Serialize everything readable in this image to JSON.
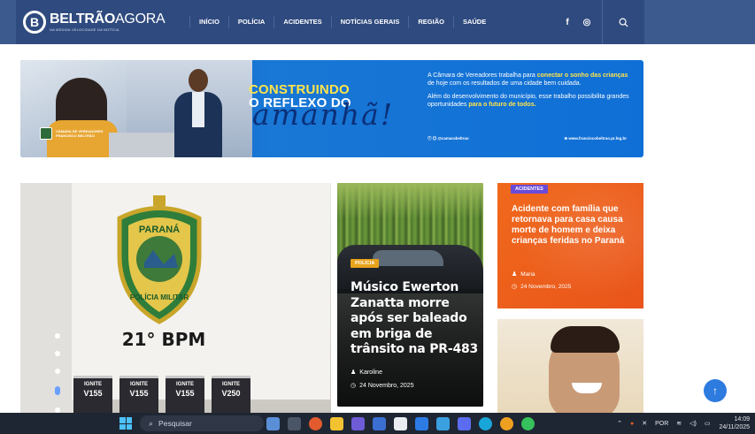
{
  "header": {
    "logo_bold": "BELTRÃO",
    "logo_light": "AGORA",
    "logo_tagline": "NA MEDIDA VELOCIDADE DA NOTÍCIA",
    "nav": [
      "INÍCIO",
      "POLÍCIA",
      "ACIDENTES",
      "NOTÍCIAS GERAIS",
      "REGIÃO",
      "SAÚDE"
    ],
    "social": {
      "facebook": "f",
      "instagram": "◎"
    }
  },
  "banner": {
    "seal_line1": "CÂMARA DE VEREADORES",
    "seal_line2": "FRANCISCO BELTRÃO",
    "title_line1": "CONSTRUINDO",
    "title_line2": "O REFLEXO DO",
    "script": "amanhã!",
    "p1_a": "A Câmara de Vereadores  trabalha para ",
    "p1_hl": "conectar o sonho das crianças",
    "p1_b": " de hoje com os resultados de uma cidade bem cuidada.",
    "p2_a": "Além do desenvolvimento do município, esse trabalho possibilita grandes oportunidades ",
    "p2_hl": "para o futuro de todos.",
    "handle": "@camarabeltrao",
    "site": "www.franciscobeltrao.pr.leg.br"
  },
  "slider": {
    "emblem_top": "PARANÁ",
    "emblem_bottom": "POLÍCIA MILITAR",
    "bpm": "21° BPM",
    "packs": [
      "V155",
      "V155",
      "V155",
      "V250"
    ],
    "pack_brand": "IGNITE",
    "active_dot": 4,
    "dot_count": 5
  },
  "card_mid": {
    "category": "POLÍCIA",
    "title": "Músico Ewerton Zanatta morre após ser baleado em briga de trânsito na PR-483",
    "author": "Karoline",
    "date": "24 Novembro, 2025"
  },
  "card_orange": {
    "category": "ACIDENTES",
    "title": "Acidente com família que retornava para casa causa morte de homem e deixa crianças feridas no Paraná",
    "author": "Maria",
    "date": "24 Novembro, 2025"
  },
  "taskbar": {
    "search_placeholder": "Pesquisar",
    "lang": "POR",
    "time": "14:09",
    "date": "24/11/2025"
  },
  "colors": {
    "header_bg": "#2f4a7e",
    "accent_orange": "#f0691c",
    "tag_policia": "#e8a21b",
    "tag_acidentes": "#6a4bd8",
    "to_top": "#2e7be0"
  }
}
